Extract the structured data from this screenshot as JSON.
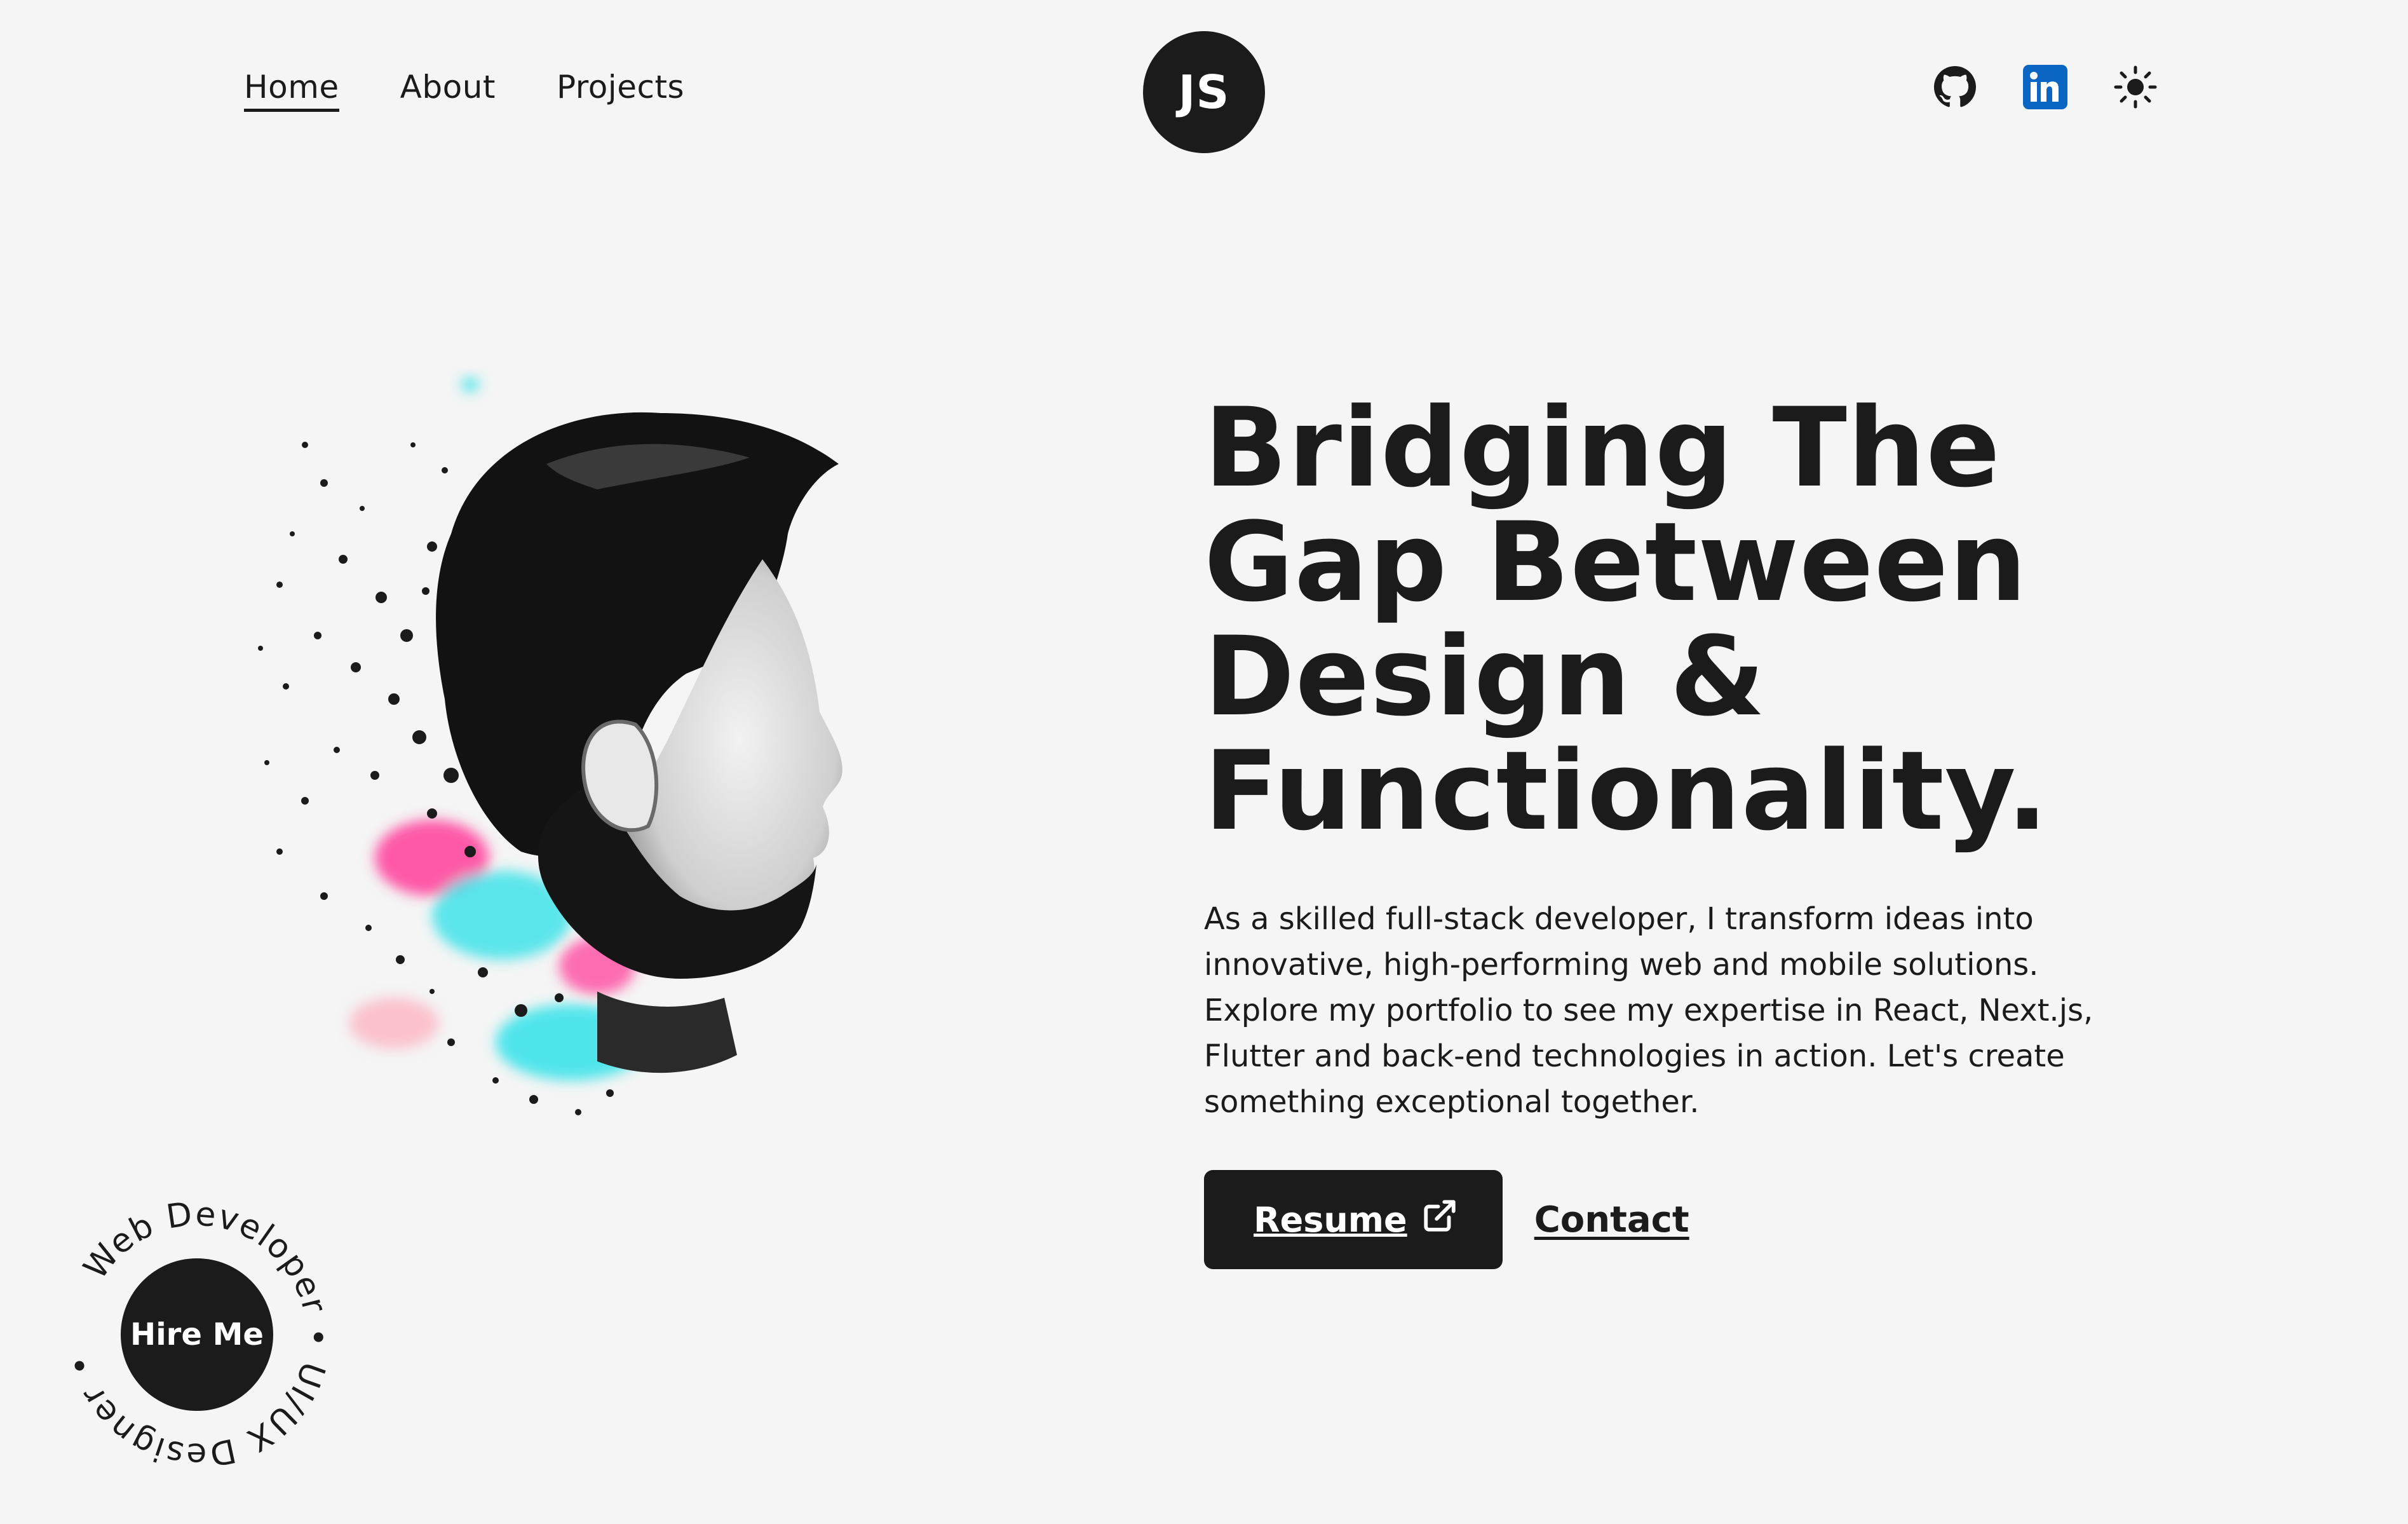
{
  "nav": {
    "items": [
      {
        "label": "Home",
        "active": true
      },
      {
        "label": "About",
        "active": false
      },
      {
        "label": "Projects",
        "active": false
      }
    ]
  },
  "logo": {
    "text": "JS"
  },
  "social": {
    "icons": [
      "github-icon",
      "linkedin-icon",
      "sun-icon"
    ],
    "linkedin_color": "#0a66c2"
  },
  "hero": {
    "title_lines": [
      "Bridging The",
      "Gap Between",
      "Design &",
      "Functionality."
    ],
    "description_lines": [
      "As a skilled full-stack developer, I transform ideas into",
      "innovative, high-performing web and mobile solutions.",
      "Explore my portfolio to see my expertise in React, Next.js,",
      "Flutter and back-end technologies in action. Let's create",
      "something exceptional together."
    ],
    "resume_label": "Resume",
    "contact_label": "Contact"
  },
  "badge": {
    "center_label": "Hire Me",
    "ring_text": "Web Developer • UI/UX Designer • "
  },
  "colors": {
    "background": "#f5f5f5",
    "text": "#1b1b1b",
    "splash_pink": "#ff3d9a",
    "splash_cyan": "#3fe3ea"
  }
}
